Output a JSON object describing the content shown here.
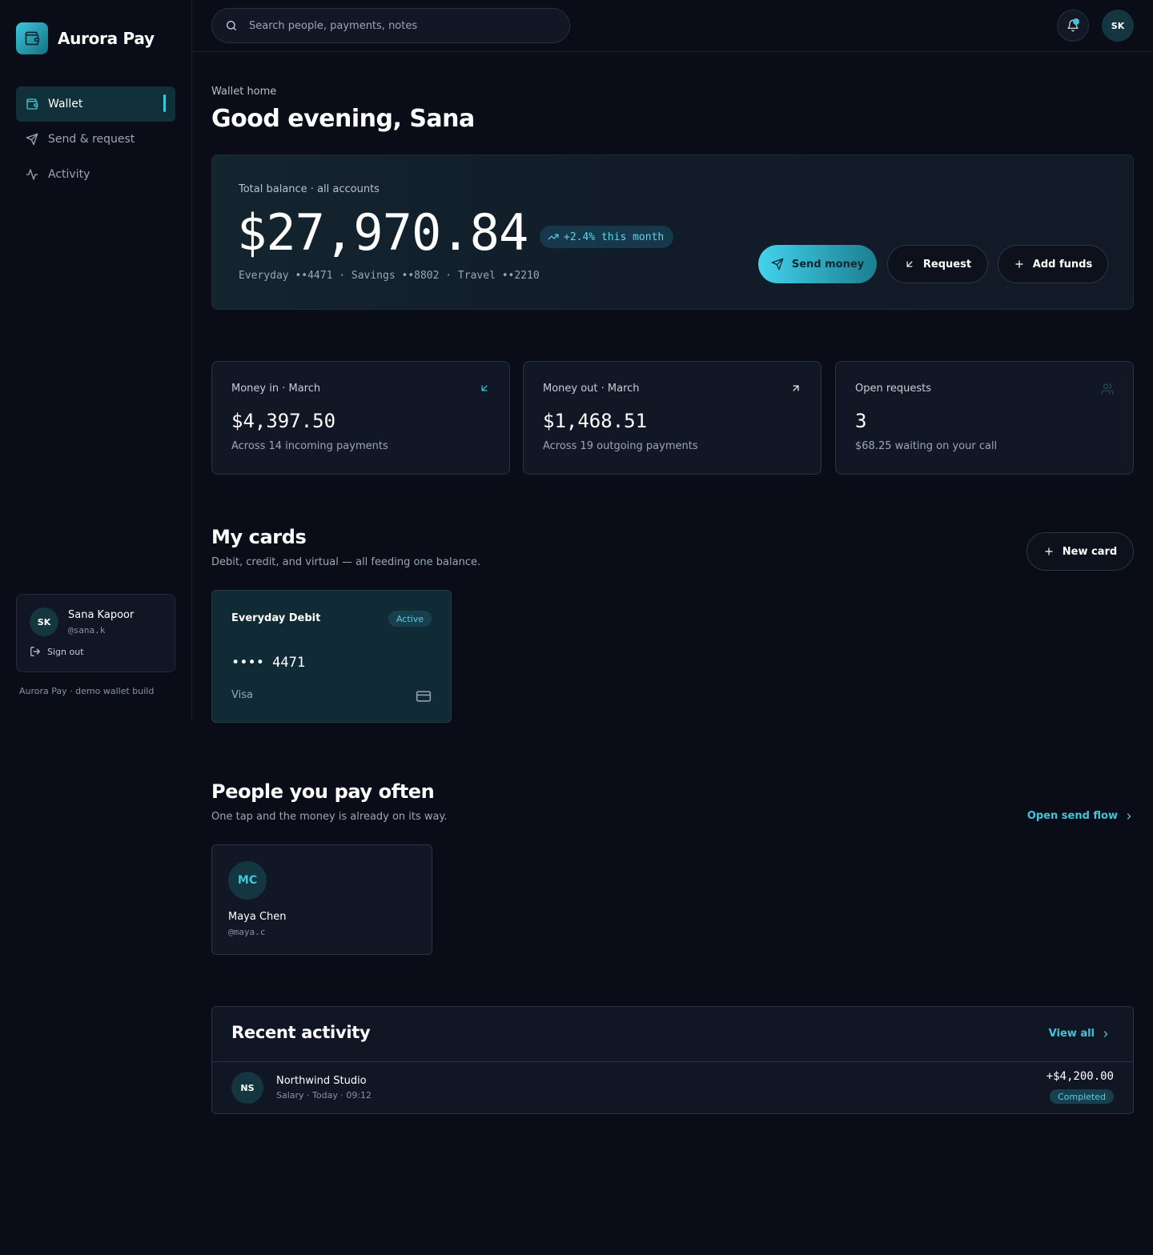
{
  "brand": {
    "name": "Aurora Pay",
    "icon": "wallet-icon"
  },
  "sidebar": {
    "items": [
      {
        "label": "Wallet",
        "icon": "wallet-icon",
        "active": true
      },
      {
        "label": "Send & request",
        "icon": "send-icon",
        "active": false
      },
      {
        "label": "Activity",
        "icon": "activity-icon",
        "active": false
      }
    ],
    "user": {
      "initials": "SK",
      "name": "Sana Kapoor",
      "handle": "@sana.k",
      "signout": "Sign out"
    },
    "build_note": "Aurora Pay · demo wallet build"
  },
  "topbar": {
    "search_placeholder": "Search people, payments, notes",
    "avatar_initials": "SK",
    "has_notification": true
  },
  "header": {
    "eyebrow": "Wallet home",
    "greeting": "Good evening, Sana"
  },
  "balance": {
    "label": "Total balance · all accounts",
    "amount": "$27,970.84",
    "trend": "+2.4% this month",
    "accounts": "Everyday ••4471 · Savings ••8802 · Travel ••2210",
    "actions": {
      "send": "Send money",
      "request": "Request",
      "add": "Add funds"
    }
  },
  "stats": [
    {
      "label": "Money in · March",
      "value": "$4,397.50",
      "sub": "Across 14 incoming payments",
      "icon": "arrow-down-left-icon"
    },
    {
      "label": "Money out · March",
      "value": "$1,468.51",
      "sub": "Across 19 outgoing payments",
      "icon": "arrow-up-right-icon"
    },
    {
      "label": "Open requests",
      "value": "3",
      "sub": "$68.25 waiting on your call",
      "icon": "users-icon"
    }
  ],
  "cards_section": {
    "title": "My cards",
    "subtitle": "Debit, credit, and virtual — all feeding one balance.",
    "new_card": "New card",
    "cards": [
      {
        "name": "Everyday Debit",
        "status": "Active",
        "number": "•••• 4471",
        "network": "Visa"
      }
    ]
  },
  "people_section": {
    "title": "People you pay often",
    "subtitle": "One tap and the money is already on its way.",
    "link": "Open send flow",
    "people": [
      {
        "initials": "MC",
        "name": "Maya Chen",
        "handle": "@maya.c"
      }
    ]
  },
  "activity": {
    "title": "Recent activity",
    "view_all": "View all",
    "rows": [
      {
        "initials": "NS",
        "name": "Northwind Studio",
        "meta": "Salary · Today · 09:12",
        "amount": "+$4,200.00",
        "status": "Completed"
      }
    ]
  },
  "colors": {
    "accent": "#3ec6dd",
    "background": "#0a0d17",
    "card": "#111725"
  }
}
